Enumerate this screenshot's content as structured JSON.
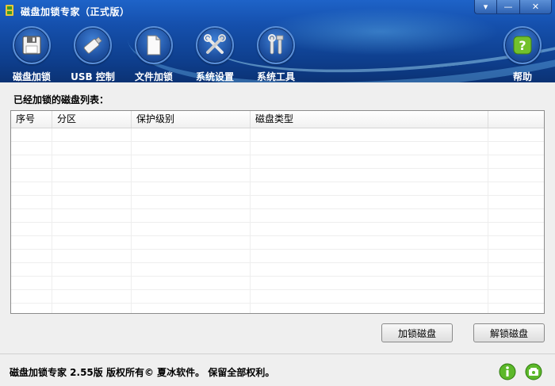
{
  "window": {
    "title": "磁盘加锁专家（正式版）",
    "controls": {
      "menu": "▾",
      "minimize": "—",
      "close": "✕"
    }
  },
  "toolbar": {
    "items": [
      {
        "label": "磁盘加锁",
        "icon": "floppy-disk-icon"
      },
      {
        "label": "USB 控制",
        "icon": "usb-drive-icon"
      },
      {
        "label": "文件加锁",
        "icon": "document-icon"
      },
      {
        "label": "系统设置",
        "icon": "tools-icon"
      },
      {
        "label": "系统工具",
        "icon": "wrench-icon"
      }
    ],
    "help_label": "帮助"
  },
  "main": {
    "list_title": "已经加锁的磁盘列表：",
    "columns": [
      "序号",
      "分区",
      "保护级别",
      "磁盘类型",
      ""
    ],
    "rows": []
  },
  "actions": {
    "lock_label": "加锁磁盘",
    "unlock_label": "解锁磁盘"
  },
  "footer": {
    "copyright": "磁盘加锁专家 2.55版  版权所有© 夏冰软件。 保留全部权利。",
    "icons": [
      "info-icon",
      "register-icon"
    ]
  },
  "colors": {
    "header_blue": "#1550ad",
    "window_bg": "#efefef",
    "help_green": "#6bbf2a"
  }
}
